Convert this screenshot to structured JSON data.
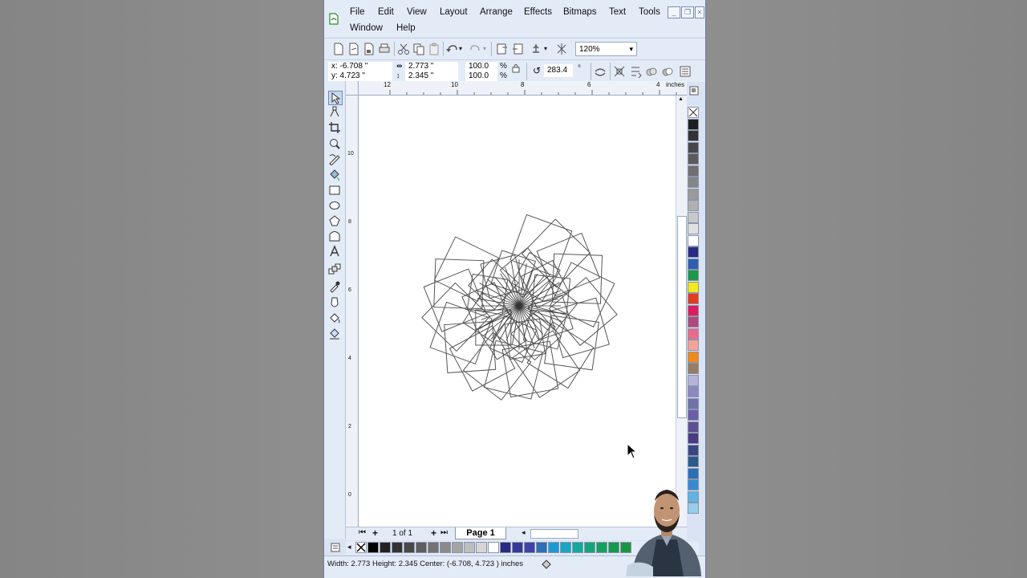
{
  "menu": {
    "file": "File",
    "edit": "Edit",
    "view": "View",
    "layout": "Layout",
    "arrange": "Arrange",
    "effects": "Effects",
    "bitmaps": "Bitmaps",
    "text": "Text",
    "tools": "Tools",
    "window": "Window",
    "help": "Help"
  },
  "zoom": "120%",
  "property_bar": {
    "x": "x:  -6.708 \"",
    "y": "y:  4.723 \"",
    "width": "2.773 \"",
    "height": "2.345 \"",
    "scale_x": "100.0",
    "scale_y": "100.0",
    "percent_x": "%",
    "percent_y": "%",
    "rotation": "283.4",
    "degree": "°"
  },
  "ruler": {
    "unit": "inches",
    "h_ticks": [
      "12",
      "10",
      "8",
      "6",
      "4"
    ],
    "v_ticks": [
      "10",
      "8",
      "6",
      "4",
      "2",
      "0"
    ]
  },
  "page_nav": {
    "count": "1 of 1",
    "tab": "Page 1"
  },
  "status": {
    "text": "Width: 2.773  Height: 2.345  Center: (-6.708, 4.723 )  inches"
  },
  "palette_colors": [
    "#1e1e1e",
    "#333333",
    "#474747",
    "#5b5b5b",
    "#6f6f6f",
    "#858585",
    "#9a9a9a",
    "#b0b0b0",
    "#c8c8c8",
    "#e0e0e0",
    "#ffffff",
    "#2b2a83",
    "#2e5fb0",
    "#1d9748",
    "#f3ea1d",
    "#e23c23",
    "#d81e5b",
    "#b0497b",
    "#e96b8c",
    "#f2a49b",
    "#ee8a1e",
    "#9a7b66",
    "#b7b3d6",
    "#8e88c0",
    "#7272aa",
    "#6b5ea6",
    "#5e4f93",
    "#4a3b81",
    "#3a4680",
    "#2b5a8a",
    "#2d6fb4",
    "#3a89d0",
    "#63b2e5",
    "#95cdea"
  ],
  "doc_colors": [
    "#000000",
    "#222222",
    "#333333",
    "#484848",
    "#5e5e5e",
    "#727272",
    "#8a8a8a",
    "#a4a4a4",
    "#bdbdbd",
    "#d6d6d6",
    "#ffffff",
    "#2b2a83",
    "#3a3896",
    "#4042a6",
    "#2d6fb4",
    "#1c9ad6",
    "#18a5c6",
    "#16a89e",
    "#14a47a",
    "#13a05d",
    "#149a48",
    "#1b9640"
  ]
}
